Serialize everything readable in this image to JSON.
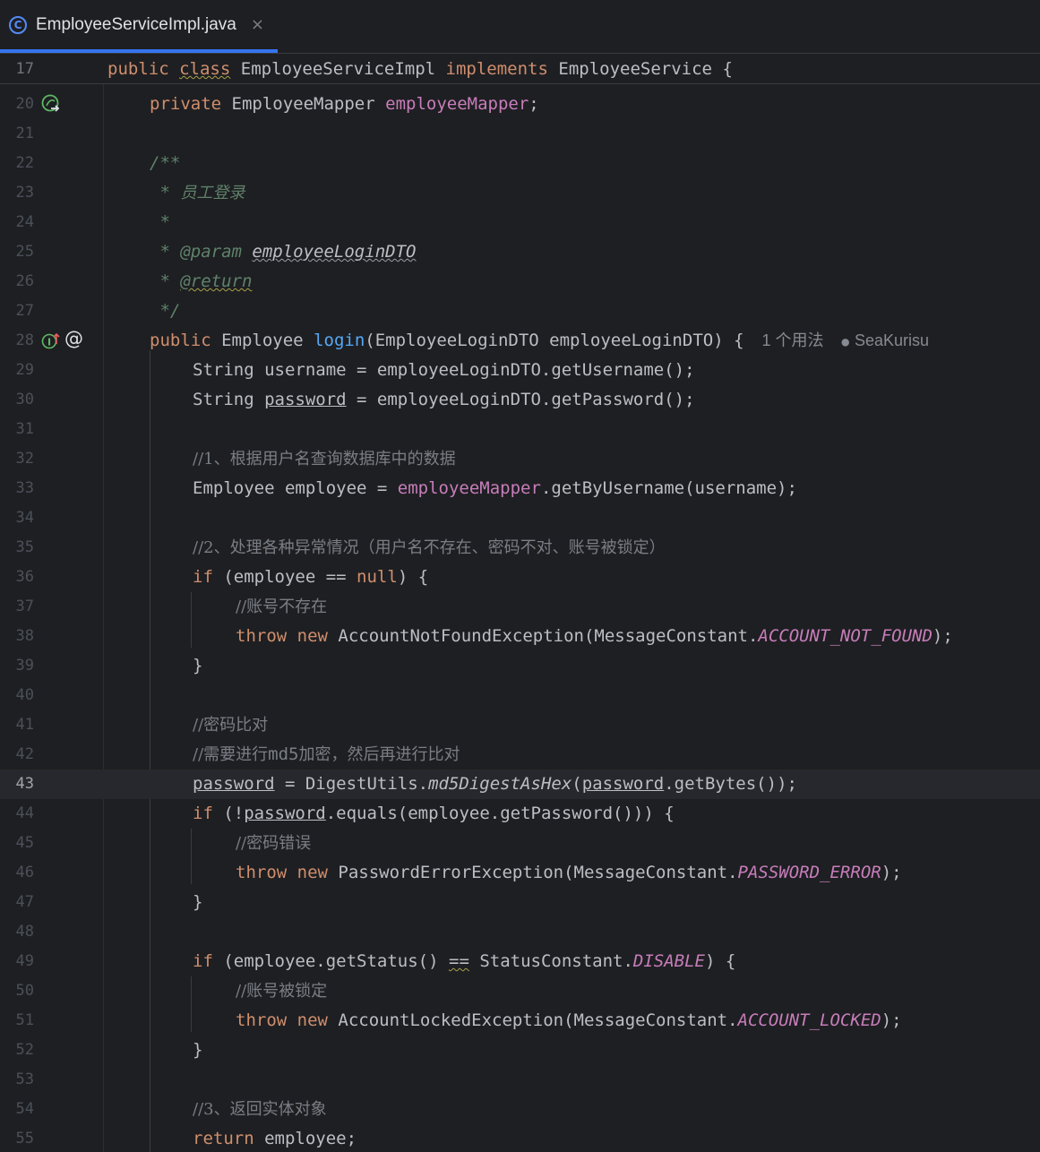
{
  "tab": {
    "filename": "EmployeeServiceImpl.java",
    "close_glyph": "×",
    "icon_letter": "C"
  },
  "sticky": {
    "line_number": "17",
    "public_kw": "public",
    "class_kw": "class",
    "class_name": "EmployeeServiceImpl",
    "implements_kw": "implements",
    "interface_name": "EmployeeService",
    "brace": "{"
  },
  "lines": {
    "l20": "20",
    "l21": "21",
    "l22": "22",
    "l23": "23",
    "l24": "24",
    "l25": "25",
    "l26": "26",
    "l27": "27",
    "l28": "28",
    "l29": "29",
    "l30": "30",
    "l31": "31",
    "l32": "32",
    "l33": "33",
    "l34": "34",
    "l35": "35",
    "l36": "36",
    "l37": "37",
    "l38": "38",
    "l39": "39",
    "l40": "40",
    "l41": "41",
    "l42": "42",
    "l43": "43",
    "l44": "44",
    "l45": "45",
    "l46": "46",
    "l47": "47",
    "l48": "48",
    "l49": "49",
    "l50": "50",
    "l51": "51",
    "l52": "52",
    "l53": "53",
    "l54": "54",
    "l55": "55"
  },
  "code": {
    "private": "private",
    "public": "public",
    "string": "String",
    "employee_mapper_type": "EmployeeMapper",
    "employee_mapper_field": "employeeMapper",
    "semicolon": ";",
    "doc_open": "/**",
    "doc_star": " * ",
    "doc_star_only": " *",
    "doc_desc": "员工登录",
    "doc_param_tag": "@param",
    "doc_param_name": "employeeLoginDTO",
    "doc_return_tag": "@return",
    "doc_close": " */",
    "employee_type": "Employee",
    "login_method": "login",
    "login_params": "(EmployeeLoginDTO employeeLoginDTO) {",
    "usages_inlay": "1 个用法",
    "author_inlay": "SeaKurisu",
    "username_assign": " username = employeeLoginDTO.getUsername();",
    "password_var": "password",
    "password_rest": " = employeeLoginDTO.getPassword();",
    "comment_1": "//1、根据用户名查询数据库中的数据",
    "line33_a": "Employee employee = ",
    "line33_b": ".getByUsername(username);",
    "comment_2": "//2、处理各种异常情况（用户名不存在、密码不对、账号被锁定）",
    "if_kw": "if",
    "line36_a": " (employee == ",
    "null_kw": "null",
    "line36_b": ") {",
    "comment_account_missing": "//账号不存在",
    "throw_kw": "throw",
    "new_kw": "new",
    "line38_a": " AccountNotFoundException(MessageConstant.",
    "const_not_found": "ACCOUNT_NOT_FOUND",
    "close_paren_semi": ");",
    "close_brace": "}",
    "comment_pw_compare": "//密码比对",
    "comment_md5_a": "//需要进行",
    "comment_md5_b": "md5",
    "comment_md5_c": "加密，然后再进行比对",
    "line43_a": " = DigestUtils.",
    "md5_method": "md5DigestAsHex",
    "line43_b": "(",
    "line43_c": ".getBytes());",
    "line44_a": " (!",
    "line44_b": ".equals(employee.getPassword())) {",
    "comment_pw_error": "//密码错误",
    "line46_a": " PasswordErrorException(MessageConstant.",
    "const_pw_error": "PASSWORD_ERROR",
    "line49_a": " (employee.getStatus() ",
    "eq_op": "==",
    "line49_b": " StatusConstant.",
    "const_disable": "DISABLE",
    "line49_c": ") {",
    "comment_locked": "//账号被锁定",
    "line51_a": " AccountLockedException(MessageConstant.",
    "const_locked": "ACCOUNT_LOCKED",
    "comment_3": "//3、返回实体对象",
    "return_kw": "return",
    "line55_a": " employee;"
  },
  "gutter": {
    "implements_marker": "I",
    "at_marker": "@"
  },
  "colors": {
    "background": "#1e1f22",
    "keyword": "#cf8e6d",
    "field": "#c77dba",
    "method_decl": "#56a8f5",
    "comment": "#7a7e85",
    "doc_comment": "#5f826b",
    "tab_accent": "#3574f0"
  }
}
